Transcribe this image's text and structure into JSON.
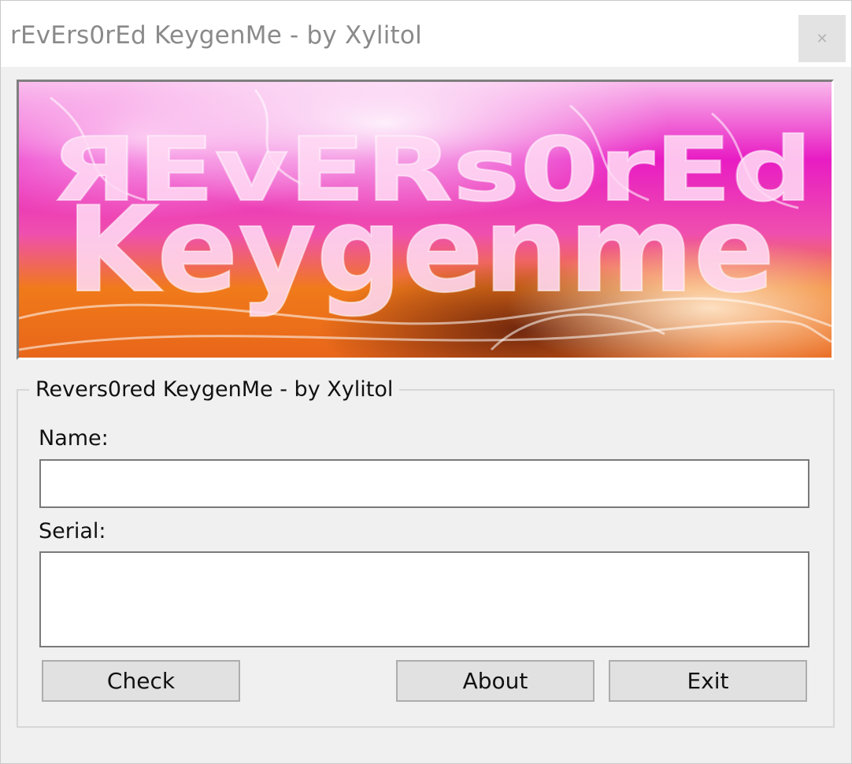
{
  "window": {
    "title": "rEvErs0rEd KeygenMe - by Xylitol",
    "close_symbol": "✕"
  },
  "banner": {
    "line1": "ЯEvERs0rEd",
    "line2": "Keygenme"
  },
  "group": {
    "title": "Revers0red KeygenMe - by Xylitol",
    "name_label": "Name:",
    "name_value": "",
    "serial_label": "Serial:",
    "serial_value": ""
  },
  "buttons": {
    "check": "Check",
    "about": "About",
    "exit": "Exit"
  },
  "colors": {
    "banner_magenta": "#e81cc3",
    "banner_pink": "#f78ad8",
    "banner_orange": "#f07a1a",
    "banner_dark": "#5a1a0a"
  }
}
